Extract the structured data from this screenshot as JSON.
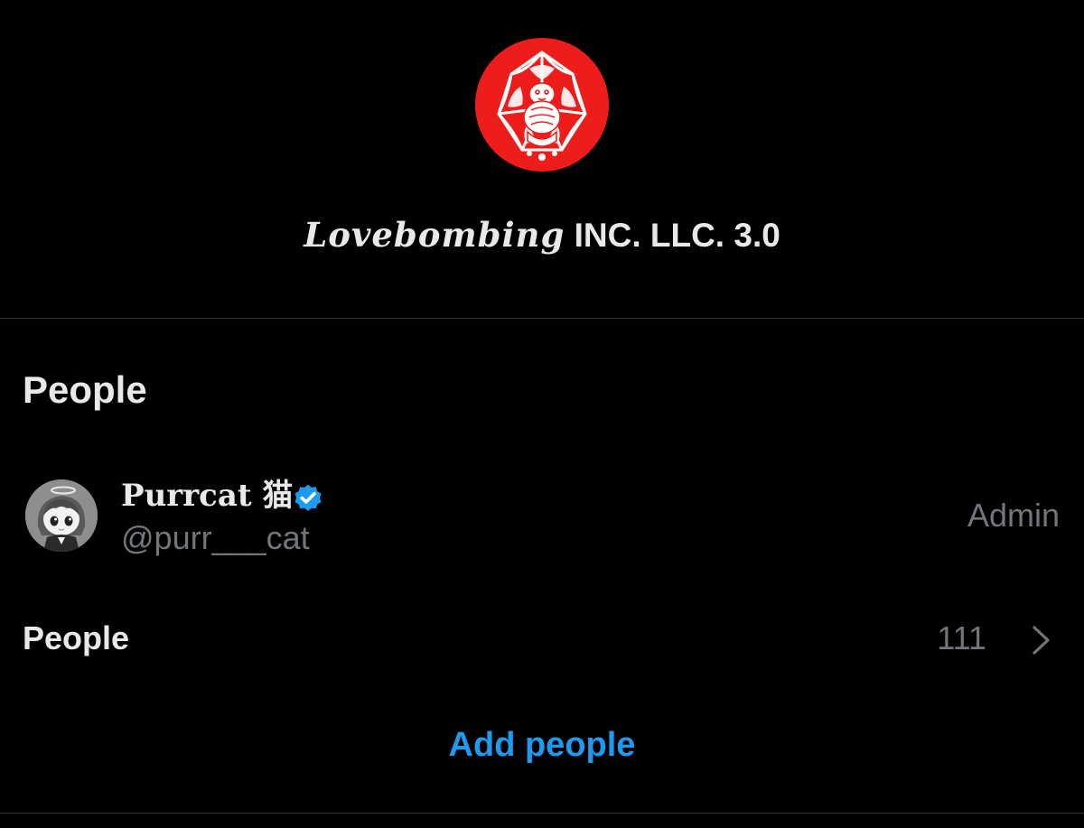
{
  "group": {
    "avatar_icon": "group-crest-icon",
    "title_fancy": "Lovebombing",
    "title_plain": "INC. LLC. 3.0"
  },
  "people_section": {
    "heading": "People",
    "members": [
      {
        "avatar_icon": "anime-character-avatar",
        "display_name": "Purrcat 猫",
        "verified_icon": "verified-badge-icon",
        "handle": "@purr___cat",
        "role": "Admin"
      }
    ],
    "people_row": {
      "label": "People",
      "count": "111",
      "chevron_icon": "chevron-right-icon"
    },
    "add_people_label": "Add people"
  },
  "colors": {
    "background": "#000000",
    "primary_text": "#e7e9ea",
    "secondary_text": "#71767b",
    "accent_blue": "#1d9bf0",
    "divider": "#2f3336",
    "group_avatar_red": "#ef1c1c"
  }
}
